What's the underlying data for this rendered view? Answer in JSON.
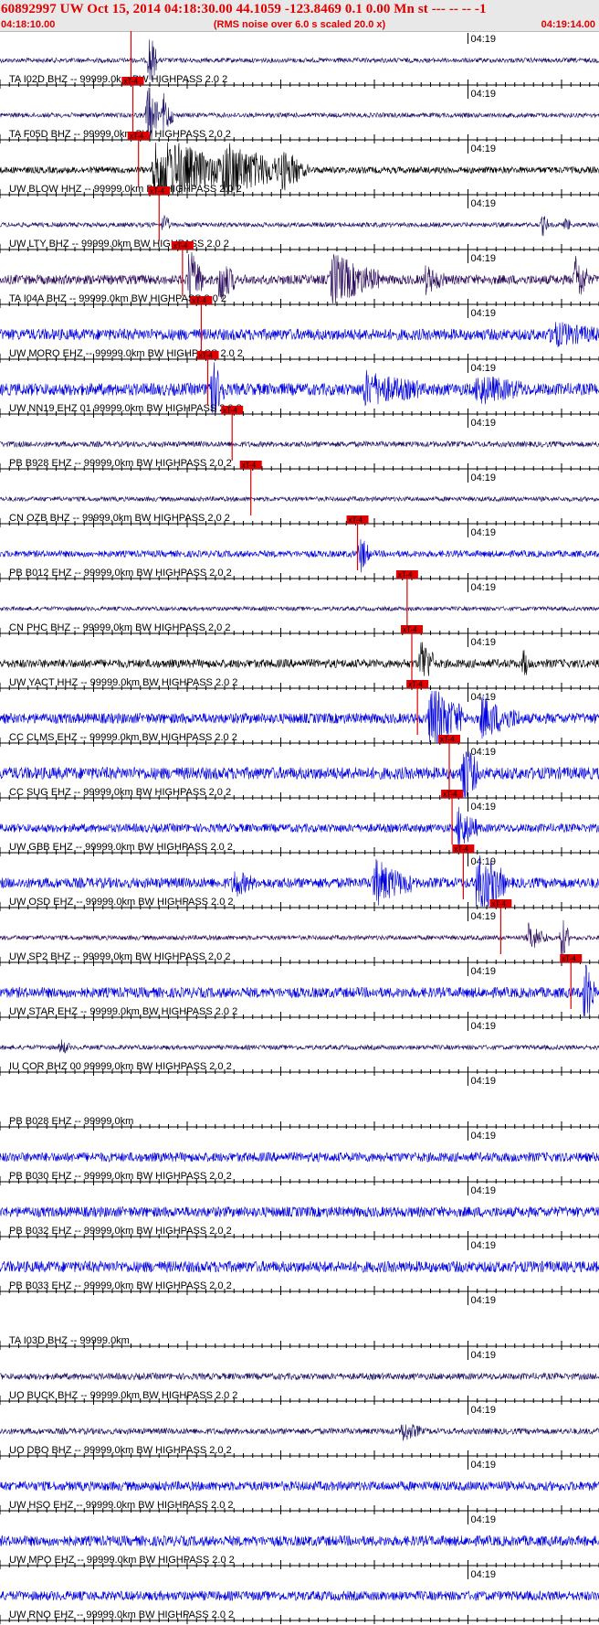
{
  "header": {
    "title": "60892997 UW Oct 15, 2014 04:18:30.00   44.1059 -123.8469  0.1 0.00 Mn st --- -- --  -1",
    "subtitle": "(RMS noise over 6.0 s scaled 20.0 x)",
    "start_time": "04:18:10.00",
    "end_time": "04:19:14.00"
  },
  "colors": {
    "header_text": "#e00000",
    "pick": "#e00000",
    "trace_black": "#000000",
    "trace_navy": "#1a1266",
    "trace_blue": "#0000dd",
    "trace_purple": "#2a0a5a"
  },
  "chart_data": {
    "type": "line",
    "title": "60892997 UW Oct 15, 2014 04:18:30.00   44.1059 -123.8469  0.1 0.00 Mn st --- -- --  -1",
    "subtitle": "(RMS noise over 6.0 s scaled 20.0 x)",
    "x_range_seconds": [
      0,
      64
    ],
    "tick_label": "04:19",
    "tick_label_seconds": 50,
    "pick_label": "xT-4",
    "grid": false,
    "series": [
      {
        "label": "TA I02D BHZ -- 99999.0km BW  HIGHPASS  2.0  2",
        "color": "#1a1266",
        "noise": 0.1,
        "pick": 14.0,
        "bursts": [
          [
            16.0,
            0.8,
            1.3
          ]
        ]
      },
      {
        "label": "TA F05D BHZ -- 99999.0km BW  HIGHPASS  2.0  2",
        "color": "#1a1266",
        "noise": 0.1,
        "pick": 14.2,
        "bursts": [
          [
            15.8,
            1.2,
            1.6
          ],
          [
            17.5,
            1.0,
            0.9
          ]
        ]
      },
      {
        "label": "UW BLOW HHZ -- 99999.0km BW  HIGHPASS  2.0  2",
        "color": "#000000",
        "noise": 0.14,
        "pick": 14.8,
        "bursts": [
          [
            16.5,
            8.0,
            1.8
          ],
          [
            24.0,
            8.0,
            1.2
          ],
          [
            30.0,
            3.0,
            0.5
          ]
        ]
      },
      {
        "label": "UW LTY BHZ -- 99999.0km BW  HIGHPASS  2.0  2",
        "color": "#1a1266",
        "noise": 0.1,
        "pick": 17.0,
        "bursts": [
          [
            17.5,
            0.6,
            0.5
          ],
          [
            58.0,
            0.6,
            0.45
          ],
          [
            60.5,
            0.4,
            0.3
          ]
        ]
      },
      {
        "label": "TA I04A BHZ -- 99999.0km BW  HIGHPASS  2.0  2",
        "color": "#2a0a5a",
        "noise": 0.2,
        "pick": 19.5,
        "bursts": [
          [
            20.2,
            1.6,
            1.3
          ],
          [
            23.5,
            1.6,
            1.0
          ],
          [
            35.5,
            5.0,
            1.1
          ],
          [
            45.5,
            2.0,
            0.5
          ],
          [
            61.5,
            1.5,
            1.0
          ]
        ]
      },
      {
        "label": "UW MORO EHZ -- 99999.0km BW  HIGHPASS  2.0  2",
        "color": "#0000dd",
        "noise": 0.24,
        "pick": 21.5,
        "bursts": [
          [
            59.0,
            5.0,
            0.4
          ]
        ]
      },
      {
        "label": "UW NN19 EHZ 01 99999.0km BW  HIGHPASS  2.0  2",
        "color": "#0000dd",
        "noise": 0.26,
        "pick": 22.2,
        "bursts": [
          [
            22.5,
            1.5,
            1.3
          ],
          [
            39.0,
            6.0,
            0.6
          ],
          [
            51.0,
            5.0,
            0.5
          ]
        ]
      },
      {
        "label": "PB B928 EHZ -- 99999.0km BW  HIGHPASS  2.0  2",
        "color": "#1a1266",
        "noise": 0.12,
        "pick": 24.8,
        "bursts": []
      },
      {
        "label": "CN OZB BHZ -- 99999.0km BW  HIGHPASS  2.0  2",
        "color": "#1a1266",
        "noise": 0.1,
        "pick": 26.8,
        "bursts": []
      },
      {
        "label": "PB B012 EHZ -- 99999.0km BW  HIGHPASS  2.0  2",
        "color": "#0000dd",
        "noise": 0.14,
        "pick": 38.2,
        "bursts": [
          [
            38.5,
            1.0,
            0.8
          ]
        ]
      },
      {
        "label": "CN PHC BHZ -- 99999.0km BW  HIGHPASS  2.0  2",
        "color": "#1a1266",
        "noise": 0.09,
        "pick": 43.5,
        "bursts": []
      },
      {
        "label": "UW YACT HHZ -- 99999.0km BW  HIGHPASS  2.0  2",
        "color": "#000000",
        "noise": 0.18,
        "pick": 44.0,
        "bursts": [
          [
            45.0,
            1.5,
            1.1
          ],
          [
            56.0,
            0.5,
            0.6
          ]
        ]
      },
      {
        "label": "CC CLMS EHZ -- 99999.0km BW  HIGHPASS  2.0  2",
        "color": "#0000dd",
        "noise": 0.22,
        "pick": 44.6,
        "bursts": [
          [
            46.0,
            3.5,
            1.6
          ],
          [
            51.5,
            4.0,
            0.8
          ]
        ]
      },
      {
        "label": "CC SUG EHZ -- 99999.0km BW  HIGHPASS  2.0  2",
        "color": "#0000dd",
        "noise": 0.26,
        "pick": 48.0,
        "bursts": [
          [
            49.5,
            1.5,
            1.5
          ]
        ]
      },
      {
        "label": "UW GBB EHZ -- 99999.0km BW  HIGHPASS  2.0  2",
        "color": "#0000dd",
        "noise": 0.18,
        "pick": 48.3,
        "bursts": [
          [
            49.0,
            2.0,
            0.9
          ]
        ]
      },
      {
        "label": "UW OSD EHZ -- 99999.0km BW  HIGHPASS  2.0  2",
        "color": "#0000dd",
        "noise": 0.22,
        "pick": 49.5,
        "bursts": [
          [
            40.0,
            4.0,
            0.9
          ],
          [
            51.0,
            3.0,
            1.6
          ],
          [
            25.0,
            2.0,
            0.5
          ]
        ]
      },
      {
        "label": "UW SP2 BHZ -- 99999.0km BW  HIGHPASS  2.0  2",
        "color": "#2a0a5a",
        "noise": 0.1,
        "pick": 53.5,
        "bursts": [
          [
            56.5,
            2.0,
            0.6
          ],
          [
            60.0,
            0.8,
            1.0
          ]
        ]
      },
      {
        "label": "UW STAR EHZ -- 99999.0km BW  HIGHPASS  2.0  2",
        "color": "#0000dd",
        "noise": 0.22,
        "pick": 61.0,
        "bursts": [
          [
            62.5,
            1.0,
            1.6
          ]
        ]
      },
      {
        "label": "IU COR BHZ 00 99999.0km BW  HIGHPASS  2.0  2",
        "color": "#1a1266",
        "noise": 0.1,
        "pick": null,
        "bursts": [
          [
            6.5,
            1.0,
            0.3
          ]
        ]
      },
      {
        "label": "PB B028 EHZ -- 99999.0km",
        "color": "#0000dd",
        "noise": 0.0,
        "pick": null,
        "bursts": []
      },
      {
        "label": "PB B030 EHZ -- 99999.0km BW  HIGHPASS  2.0  2",
        "color": "#0000dd",
        "noise": 0.2,
        "pick": null,
        "bursts": []
      },
      {
        "label": "PB B032 EHZ -- 99999.0km BW  HIGHPASS  2.0  2",
        "color": "#0000dd",
        "noise": 0.22,
        "pick": null,
        "bursts": []
      },
      {
        "label": "PB B033 EHZ -- 99999.0km BW  HIGHPASS  2.0  2",
        "color": "#0000dd",
        "noise": 0.24,
        "pick": null,
        "bursts": []
      },
      {
        "label": "TA I03D BHZ -- 99999.0km",
        "color": "#1a1266",
        "noise": 0.0,
        "pick": null,
        "bursts": []
      },
      {
        "label": "UO BUCK BHZ -- 99999.0km BW  HIGHPASS  2.0  2",
        "color": "#1a1266",
        "noise": 0.14,
        "pick": null,
        "bursts": []
      },
      {
        "label": "UO DBO BHZ -- 99999.0km BW  HIGHPASS  2.0  2",
        "color": "#1a1266",
        "noise": 0.13,
        "pick": null,
        "bursts": [
          [
            43.0,
            2.0,
            0.4
          ]
        ]
      },
      {
        "label": "UW HSO EHZ -- 99999.0km BW  HIGHPASS  2.0  2",
        "color": "#0000dd",
        "noise": 0.2,
        "pick": null,
        "bursts": []
      },
      {
        "label": "UW MPO EHZ -- 99999.0km BW  HIGHPASS  2.0  2",
        "color": "#0000dd",
        "noise": 0.22,
        "pick": null,
        "bursts": []
      },
      {
        "label": "UW RNO EHZ -- 99999.0km BW  HIGHPASS  2.0  2",
        "color": "#0000dd",
        "noise": 0.2,
        "pick": null,
        "bursts": []
      }
    ]
  }
}
